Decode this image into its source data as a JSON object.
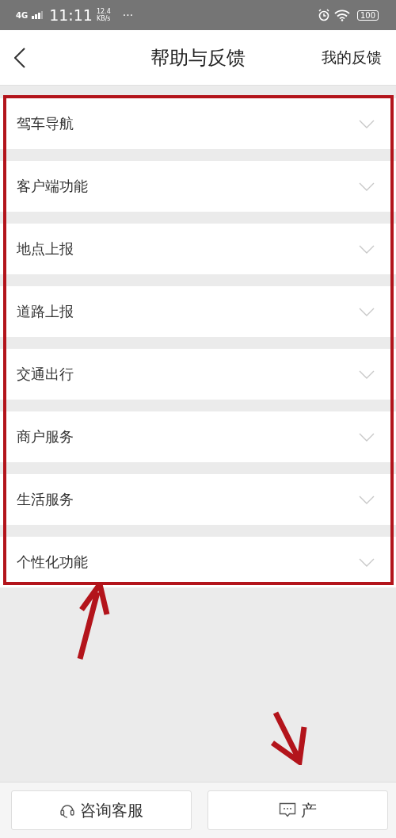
{
  "status_bar": {
    "network": "4G",
    "time": "11:11",
    "speed": "12.4",
    "speed_unit": "KB/s",
    "more": "···",
    "battery": "100"
  },
  "header": {
    "title": "帮助与反馈",
    "action": "我的反馈"
  },
  "categories": [
    {
      "label": "驾车导航",
      "expanded": false
    },
    {
      "label": "客户端功能",
      "expanded": false
    },
    {
      "label": "地点上报",
      "expanded": false
    },
    {
      "label": "道路上报",
      "expanded": false
    },
    {
      "label": "交通出行",
      "expanded": false
    },
    {
      "label": "商户服务",
      "expanded": false
    },
    {
      "label": "生活服务",
      "expanded": false
    },
    {
      "label": "个性化功能",
      "expanded": false
    }
  ],
  "bottom_buttons": [
    {
      "kind": "headset",
      "label": "咨询客服"
    },
    {
      "kind": "chat",
      "label": "产"
    }
  ]
}
